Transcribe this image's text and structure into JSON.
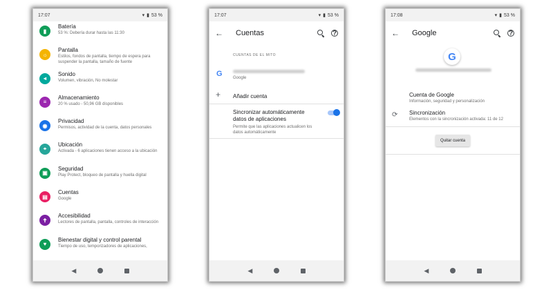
{
  "colors": {
    "accent": "#1a73e8",
    "toggle_track": "#a8c7fa"
  },
  "phone1": {
    "time": "17:07",
    "battery": "53 %",
    "items": [
      {
        "title": "Batería",
        "subtitle": "53 %: Debería durar hasta las 11:30",
        "icon": "battery-icon",
        "color": "#0f9d58"
      },
      {
        "title": "Pantalla",
        "subtitle": "Estilos, fondos de pantalla, tiempo de espera para suspender la pantalla, tamaño de fuente",
        "icon": "brightness-icon",
        "color": "#f4b400"
      },
      {
        "title": "Sonido",
        "subtitle": "Volumen, vibración, No molestar",
        "icon": "sound-icon",
        "color": "#00a99d"
      },
      {
        "title": "Almacenamiento",
        "subtitle": "20 % usado - 50,96 GB disponibles",
        "icon": "storage-icon",
        "color": "#9c27b0"
      },
      {
        "title": "Privacidad",
        "subtitle": "Permisos, actividad de la cuenta, datos personales",
        "icon": "privacy-icon",
        "color": "#1a73e8"
      },
      {
        "title": "Ubicación",
        "subtitle": "Activada - 6 aplicaciones tienen acceso a la ubicación",
        "icon": "location-icon",
        "color": "#26a69a"
      },
      {
        "title": "Seguridad",
        "subtitle": "Play Protect, bloqueo de pantalla y huella digital",
        "icon": "lock-icon",
        "color": "#0f9d58"
      },
      {
        "title": "Cuentas",
        "subtitle": "Google",
        "icon": "account-icon",
        "color": "#e91e63"
      },
      {
        "title": "Accesibilidad",
        "subtitle": "Lectores de pantalla, pantalla, controles de interacción",
        "icon": "accessibility-icon",
        "color": "#7b1fa2"
      },
      {
        "title": "Bienestar digital y control parental",
        "subtitle": "Tiempo de uso, temporizadores de aplicaciones,",
        "icon": "wellbeing-icon",
        "color": "#0f9d58"
      }
    ]
  },
  "phone2": {
    "time": "17:07",
    "battery": "53 %",
    "title": "Cuentas",
    "section_label": "CUENTAS DE EL MITO",
    "account_provider": "Google",
    "add_account": "Añadir cuenta",
    "sync_title": "Sincronizar automáticamente datos de aplicaciones",
    "sync_subtitle": "Permite que las aplicaciones actualicen los datos automáticamente",
    "sync_enabled": true
  },
  "phone3": {
    "time": "17:08",
    "battery": "53 %",
    "title": "Google",
    "account_title": "Cuenta de Google",
    "account_subtitle": "Información, seguridad y personalización",
    "sync_title": "Sincronización",
    "sync_subtitle": "Elementos con la sincronización activada: 11 de 12",
    "remove_button": "Quitar cuenta"
  }
}
